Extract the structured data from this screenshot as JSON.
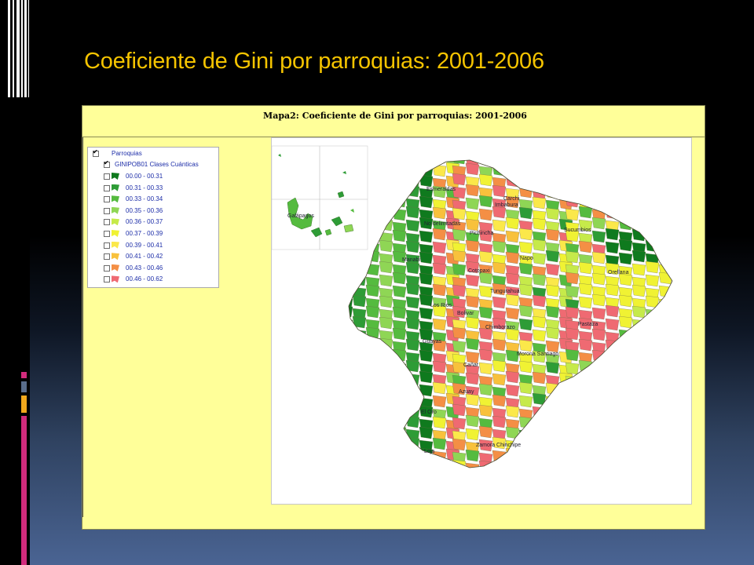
{
  "slide": {
    "title": "Coeficiente de Gini por parroquias: 2001-2006"
  },
  "map": {
    "title": "Mapa2: Coeficiente de  Gini por parroquias:  2001-2006",
    "legend": {
      "layer_label": "Parroquias",
      "field_label": "GINIPOB01 Clases Cuánticas",
      "classes": [
        {
          "label": "00.00  -  00.31",
          "color": "#0f7a1e"
        },
        {
          "label": "00.31  -  00.33",
          "color": "#2e9c36"
        },
        {
          "label": "00.33  -  00.34",
          "color": "#55bb3f"
        },
        {
          "label": "00.35  -  00.36",
          "color": "#8fd655"
        },
        {
          "label": "00.36  -  00.37",
          "color": "#c6ea4a"
        },
        {
          "label": "00.37  -  00.39",
          "color": "#f0f233"
        },
        {
          "label": "00.39  -  00.41",
          "color": "#fbe84a"
        },
        {
          "label": "00.41  -  00.42",
          "color": "#f8c13c"
        },
        {
          "label": "00.43  -  00.46",
          "color": "#f48f45"
        },
        {
          "label": "00.46  -  00.62",
          "color": "#ef6a72"
        }
      ]
    },
    "provinces": [
      "Esmeraldas",
      "Carchi",
      "Imbabura",
      "No delimitadas",
      "Pichincha",
      "Sucumbios",
      "Manabi",
      "Napo",
      "Orellana",
      "Cotopaxi",
      "Tungurahua",
      "Los Rios",
      "Bolivar",
      "Pastaza",
      "Guayas",
      "Chimborazo",
      "Morona Santiago",
      "Cañar",
      "Azuay",
      "El Oro",
      "Zamora Chinchipe",
      "Loja",
      "Galápagos"
    ]
  }
}
